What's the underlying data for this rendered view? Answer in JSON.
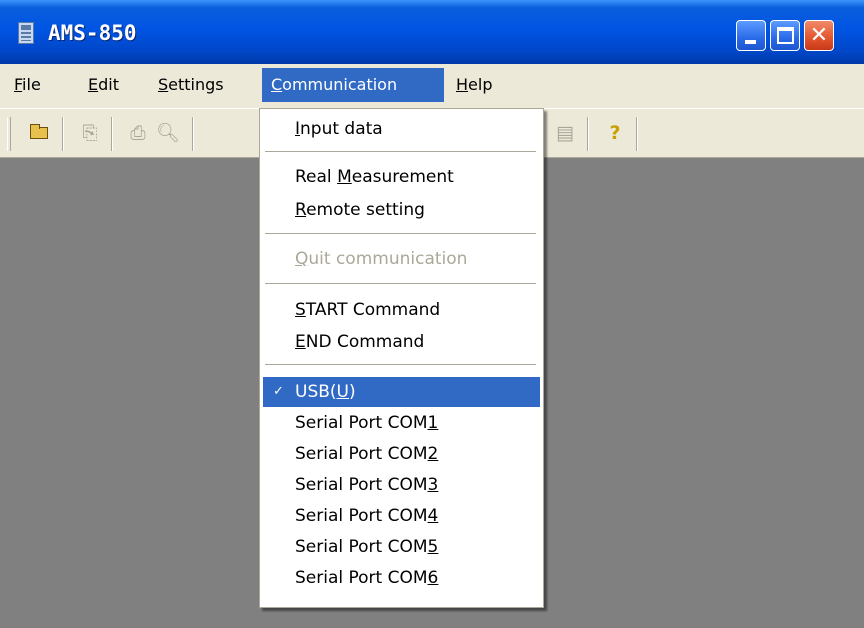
{
  "window": {
    "title": "AMS-850",
    "controls": {
      "minimize": "minimize",
      "maximize": "maximize",
      "close": "✕"
    }
  },
  "menubar": {
    "items": [
      {
        "pre": "",
        "key": "F",
        "post": "ile"
      },
      {
        "pre": "",
        "key": "E",
        "post": "dit"
      },
      {
        "pre": "",
        "key": "S",
        "post": "ettings"
      },
      {
        "pre": "",
        "key": "C",
        "post": "ommunication"
      },
      {
        "pre": "",
        "key": "H",
        "post": "elp"
      }
    ],
    "active": "Communication"
  },
  "toolbar": {
    "buttons": [
      {
        "icon": "open-folder-icon",
        "enabled": true
      },
      {
        "icon": "copy-icon",
        "enabled": false
      },
      {
        "icon": "print-icon",
        "enabled": false
      },
      {
        "icon": "print-preview-icon",
        "enabled": false
      },
      {
        "icon": "list-view-icon",
        "enabled": false
      },
      {
        "icon": "help-icon",
        "enabled": true
      }
    ]
  },
  "dropdown": {
    "items": [
      {
        "pre": "",
        "key": "I",
        "post": "nput data"
      },
      {
        "pre": "Real ",
        "key": "M",
        "post": "easurement"
      },
      {
        "pre": "",
        "key": "R",
        "post": "emote setting"
      },
      {
        "pre": "",
        "key": "Q",
        "post": "uit communication",
        "disabled": true
      },
      {
        "pre": "",
        "key": "S",
        "post": "TART Command"
      },
      {
        "pre": "",
        "key": "E",
        "post": "ND Command"
      },
      {
        "pre": "USB(",
        "key": "U",
        "post": ")",
        "checked": true,
        "check": "✓"
      },
      {
        "pre": "Serial Port COM",
        "key": "1",
        "post": ""
      },
      {
        "pre": "Serial Port COM",
        "key": "2",
        "post": ""
      },
      {
        "pre": "Serial Port COM",
        "key": "3",
        "post": ""
      },
      {
        "pre": "Serial Port COM",
        "key": "4",
        "post": ""
      },
      {
        "pre": "Serial Port COM",
        "key": "5",
        "post": ""
      },
      {
        "pre": "Serial Port COM",
        "key": "6",
        "post": ""
      }
    ]
  },
  "colors": {
    "titlebar": "#0054e3",
    "menu_highlight": "#316ac5",
    "workspace": "#808080",
    "face": "#ece9d8",
    "disabled_text": "#aca899"
  }
}
